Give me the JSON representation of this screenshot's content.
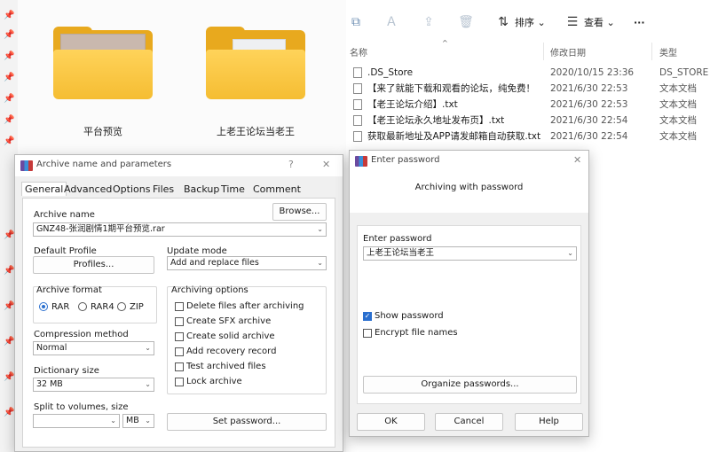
{
  "explorer_left": {
    "folders": [
      {
        "label": "平台预览"
      },
      {
        "label": "上老王论坛当老王"
      }
    ]
  },
  "explorer_right": {
    "toolbar": {
      "sort_label": "排序",
      "view_label": "查看",
      "more": "···"
    },
    "columns": {
      "name": "名称",
      "date": "修改日期",
      "type": "类型"
    },
    "files": [
      {
        "name": ".DS_Store",
        "date": "2020/10/15 23:36",
        "type": "DS_STORE 文"
      },
      {
        "name": "【来了就能下载和观看的论坛，纯免费！",
        "date": "2021/6/30 22:53",
        "type": "文本文档"
      },
      {
        "name": "【老王论坛介绍】.txt",
        "date": "2021/6/30 22:53",
        "type": "文本文档"
      },
      {
        "name": "【老王论坛永久地址发布页】.txt",
        "date": "2021/6/30 22:54",
        "type": "文本文档"
      },
      {
        "name": "获取最新地址及APP请发邮箱自动获取.txt",
        "date": "2021/6/30 22:54",
        "type": "文本文档"
      }
    ]
  },
  "archive_dialog": {
    "title": "Archive name and parameters",
    "help": "?",
    "close": "✕",
    "tabs": [
      "General",
      "Advanced",
      "Options",
      "Files",
      "Backup",
      "Time",
      "Comment"
    ],
    "archive_name_label": "Archive name",
    "browse_label": "Browse...",
    "archive_name_value": "GNZ48-张润剧情1期平台预览.rar",
    "default_profile_label": "Default Profile",
    "profiles_label": "Profiles...",
    "update_mode_label": "Update mode",
    "update_mode_value": "Add and replace files",
    "archive_format_label": "Archive format",
    "formats": [
      "RAR",
      "RAR4",
      "ZIP"
    ],
    "archiving_options_label": "Archiving options",
    "options": [
      {
        "label": "Delete files after archiving",
        "checked": false
      },
      {
        "label": "Create SFX archive",
        "checked": false
      },
      {
        "label": "Create solid archive",
        "checked": false
      },
      {
        "label": "Add recovery record",
        "checked": false
      },
      {
        "label": "Test archived files",
        "checked": false
      },
      {
        "label": "Lock archive",
        "checked": false
      }
    ],
    "compression_label": "Compression method",
    "compression_value": "Normal",
    "dictionary_label": "Dictionary size",
    "dictionary_value": "32 MB",
    "split_label": "Split to volumes, size",
    "split_unit": "MB",
    "set_password_label": "Set password..."
  },
  "password_dialog": {
    "title": "Enter password",
    "close": "✕",
    "subtitle": "Archiving with password",
    "enter_label": "Enter password",
    "password_value": "上老王论坛当老王",
    "show_password_label": "Show password",
    "encrypt_names_label": "Encrypt file names",
    "organize_label": "Organize passwords...",
    "ok_label": "OK",
    "cancel_label": "Cancel",
    "help_label": "Help"
  },
  "colors": {
    "accent": "#2a6fcf",
    "folder": "#f5bd32"
  }
}
